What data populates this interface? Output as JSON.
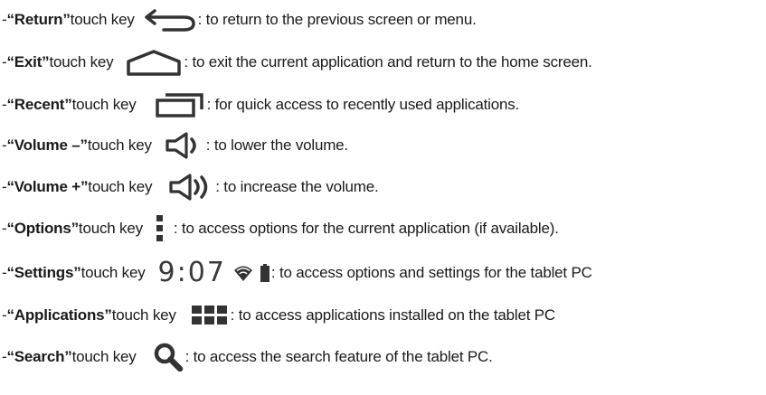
{
  "items": [
    {
      "dash": "- ",
      "open_quote": "“",
      "name": "Return",
      "close_quote": "”",
      "suffix": " touch key",
      "icon": "return-icon",
      "desc": ": to return to the previous screen or menu."
    },
    {
      "dash": "- ",
      "open_quote": "“",
      "name": "Exit",
      "close_quote": "”",
      "suffix": " touch key",
      "icon": "home-icon",
      "desc": ": to exit the current application and return to the home screen."
    },
    {
      "dash": "- ",
      "open_quote": "“",
      "name": "Recent",
      "close_quote": "”",
      "suffix": " touch key",
      "icon": "recent-apps-icon",
      "desc": ": for quick access to recently used applications."
    },
    {
      "dash": "- ",
      "open_quote": "“",
      "name": "Volume –",
      "close_quote": "”",
      "suffix": " touch key",
      "icon": "volume-down-icon",
      "desc": ": to lower the volume."
    },
    {
      "dash": "- ",
      "open_quote": "“",
      "name": "Volume +",
      "close_quote": "”",
      "suffix": " touch key",
      "icon": "volume-up-icon",
      "desc": ": to increase the volume."
    },
    {
      "dash": "- ",
      "open_quote": "“",
      "name": "Options",
      "close_quote": "”",
      "suffix": " touch key",
      "icon": "options-menu-icon",
      "desc": ": to access options for the current application (if available)."
    },
    {
      "dash": "- ",
      "open_quote": "“",
      "name": "Settings",
      "close_quote": "”",
      "suffix": " touch key",
      "icon": "status-bar-icon",
      "time": "9:07",
      "desc": ": to access options and settings for the tablet PC"
    },
    {
      "dash": "- ",
      "open_quote": "“",
      "name": "Applications",
      "close_quote": "”",
      "suffix": " touch key",
      "icon": "apps-grid-icon",
      "desc": ": to access applications installed on the tablet PC"
    },
    {
      "dash": "- ",
      "open_quote": "“",
      "name": "Search",
      "close_quote": "”",
      "suffix": " touch key",
      "icon": "search-icon",
      "desc": ": to access the search feature of the tablet PC."
    }
  ],
  "colors": {
    "text": "#1a1a1a",
    "icon": "#333333"
  }
}
